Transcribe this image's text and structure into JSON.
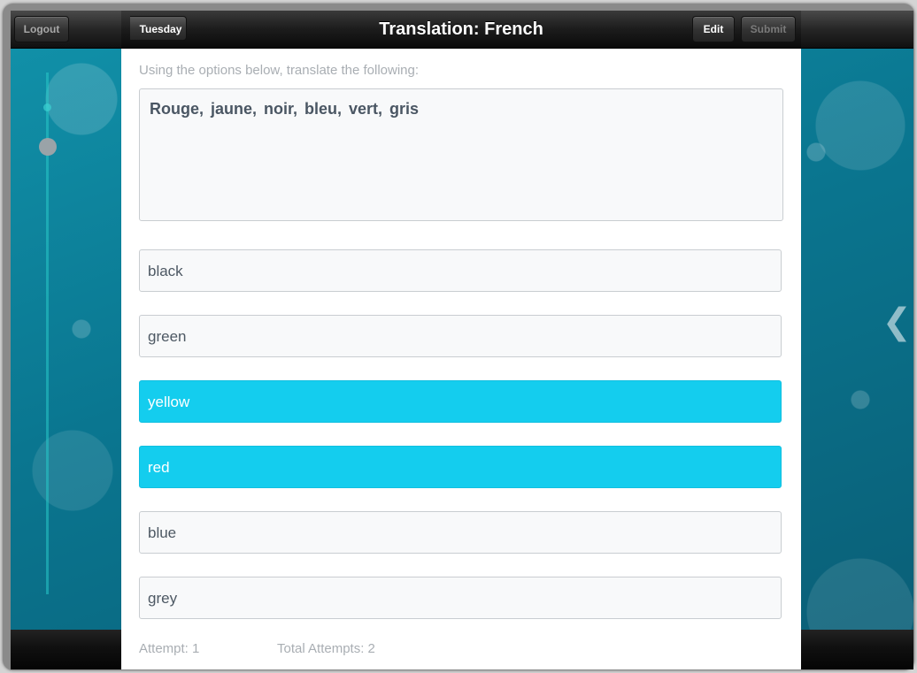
{
  "navbar": {
    "logout_label": "Logout",
    "back_label": "Tuesday",
    "title": "Translation: French",
    "edit_label": "Edit",
    "submit_label": "Submit"
  },
  "question": {
    "instructions": "Using the options below, translate the following:",
    "text": "Rouge, jaune, noir, bleu, vert, gris"
  },
  "options": [
    {
      "label": "black",
      "selected": false
    },
    {
      "label": "green",
      "selected": false
    },
    {
      "label": "yellow",
      "selected": true
    },
    {
      "label": "red",
      "selected": true
    },
    {
      "label": "blue",
      "selected": false
    },
    {
      "label": "grey",
      "selected": false
    }
  ],
  "footer": {
    "attempt": "Attempt: 1",
    "total_attempts": "Total Attempts: 2"
  },
  "colors": {
    "selected_option": "#14cdee",
    "background_teal": "#0b6f88"
  },
  "icons": {
    "right_edge": "chevron-left-icon"
  }
}
